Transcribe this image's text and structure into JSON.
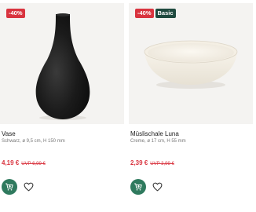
{
  "products": [
    {
      "badges": [
        "-40%"
      ],
      "name": "Vase",
      "description": "Schwarz, ø 9,5 cm, H 150 mm",
      "price": "4,19 €",
      "uvp": "UVP 6,99 €",
      "image_icon": "black-vase",
      "cart_icon": "cart-plus-icon",
      "wish_icon": "heart-icon"
    },
    {
      "badges": [
        "-40%",
        "Basic"
      ],
      "name": "Müslischale Luna",
      "description": "Creme, ø 17 cm, H 55 mm",
      "price": "2,39 €",
      "uvp": "UVP 3,99 €",
      "image_icon": "cream-bowl",
      "cart_icon": "cart-plus-icon",
      "wish_icon": "heart-icon"
    }
  ],
  "colors": {
    "discount": "#d9343f",
    "basic_badge": "#1f4a3f",
    "cart_button": "#2f7a5e",
    "image_bg": "#f4f3f1"
  }
}
